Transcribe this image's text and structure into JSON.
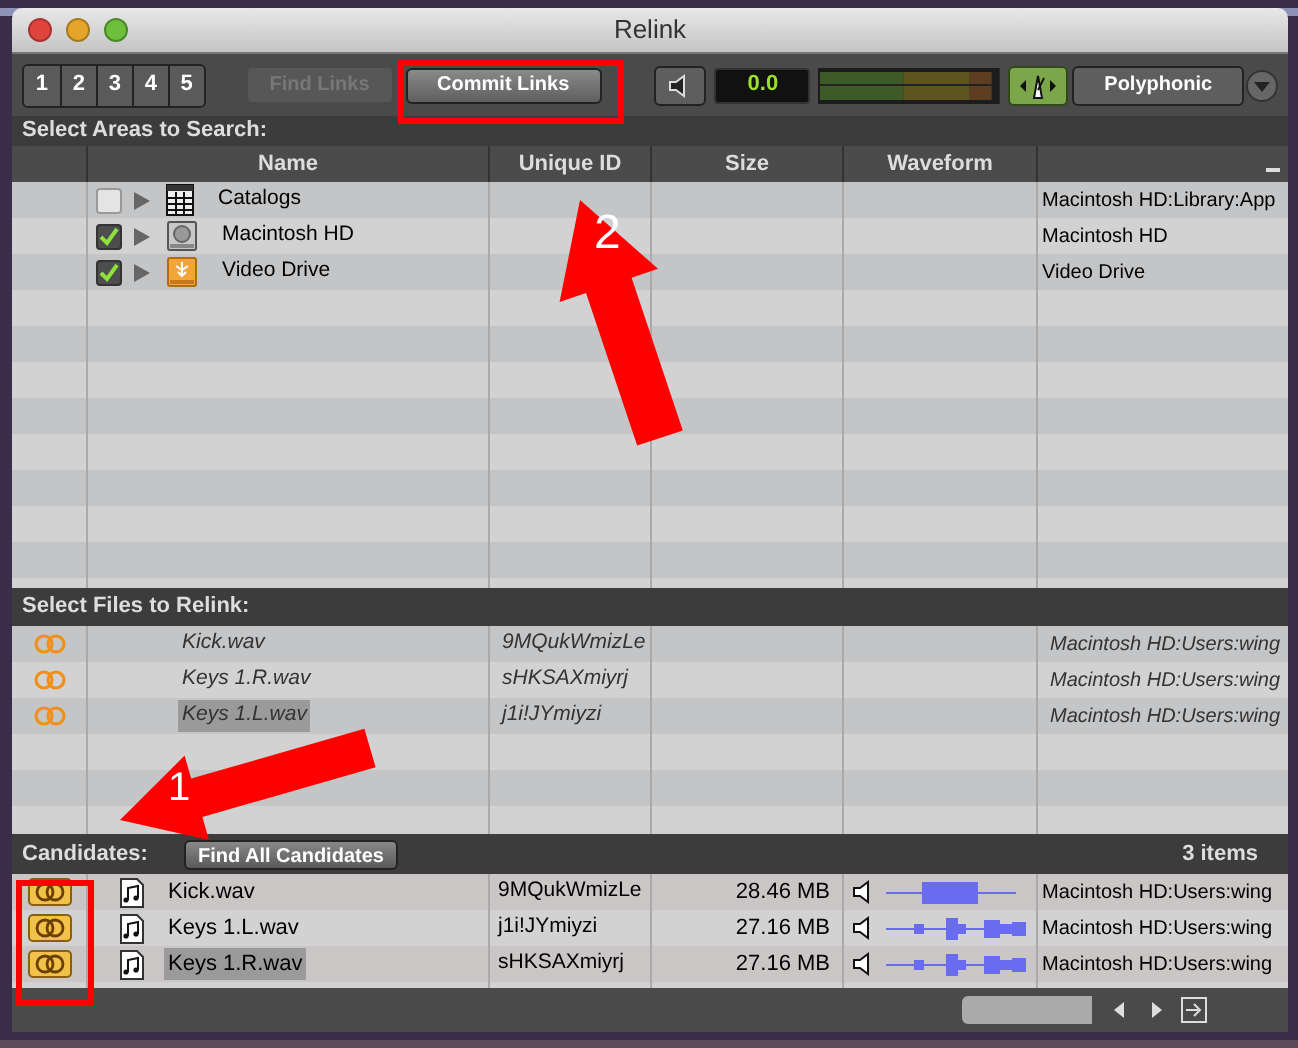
{
  "window": {
    "title": "Relink"
  },
  "toolbar": {
    "number_buttons": [
      "1",
      "2",
      "3",
      "4",
      "5"
    ],
    "find_links": {
      "label": "Find Links",
      "disabled": true
    },
    "commit_links": {
      "label": "Commit Links",
      "disabled": false
    },
    "display": "0.0",
    "mode": "Polyphonic"
  },
  "areas": {
    "title": "Select Areas to Search:",
    "columns": [
      "Name",
      "Unique ID",
      "Size",
      "Waveform"
    ],
    "items": [
      {
        "name": "Catalogs",
        "kind": "catalog",
        "checked": false,
        "path": "Macintosh HD:Library:App"
      },
      {
        "name": "Macintosh HD",
        "kind": "disk",
        "checked": true,
        "path": "Macintosh HD"
      },
      {
        "name": "Video Drive",
        "kind": "drive",
        "checked": true,
        "path": "Video Drive"
      }
    ]
  },
  "files": {
    "title": "Select Files to Relink:",
    "rows": [
      {
        "name": "Kick.wav",
        "id": "9MQukWmizLe",
        "path": "Macintosh HD:Users:wing",
        "selected": false
      },
      {
        "name": "Keys 1.R.wav",
        "id": "sHKSAXmiyrj",
        "path": "Macintosh HD:Users:wing",
        "selected": false
      },
      {
        "name": "Keys 1.L.wav",
        "id": "j1i!JYmiyzi",
        "path": "Macintosh HD:Users:wing",
        "selected": true
      }
    ]
  },
  "candidates": {
    "title": "Candidates:",
    "button": "Find All Candidates",
    "count": "3 items",
    "rows": [
      {
        "name": "Kick.wav",
        "id": "9MQukWmizLe",
        "size": "28.46 MB",
        "path": "Macintosh HD:Users:wing",
        "selected": false
      },
      {
        "name": "Keys 1.L.wav",
        "id": "j1i!JYmiyzi",
        "size": "27.16 MB",
        "path": "Macintosh HD:Users:wing",
        "selected": false
      },
      {
        "name": "Keys 1.R.wav",
        "id": "sHKSAXmiyrj",
        "size": "27.16 MB",
        "path": "Macintosh HD:Users:wing",
        "selected": true
      }
    ]
  },
  "annotations": [
    {
      "label": "2"
    },
    {
      "label": "1"
    }
  ]
}
